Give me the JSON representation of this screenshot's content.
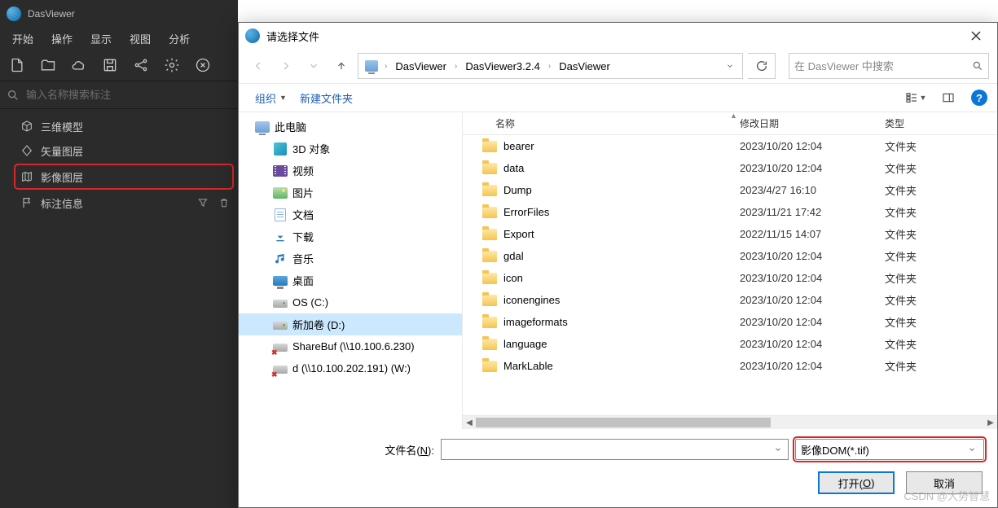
{
  "app": {
    "title": "DasViewer",
    "menubar": [
      "开始",
      "操作",
      "显示",
      "视图",
      "分析"
    ],
    "search_placeholder": "输入名称搜索标注",
    "sidebar": {
      "items": [
        {
          "label": "三维模型"
        },
        {
          "label": "矢量图层"
        },
        {
          "label": "影像图层",
          "highlighted": true
        },
        {
          "label": "标注信息",
          "has_actions": true
        }
      ]
    }
  },
  "dialog": {
    "title": "请选择文件",
    "breadcrumbs": [
      "DasViewer",
      "DasViewer3.2.4",
      "DasViewer"
    ],
    "search_placeholder": "在 DasViewer 中搜索",
    "toolbar": {
      "organize": "组织",
      "new_folder": "新建文件夹"
    },
    "tree": [
      {
        "label": "此电脑",
        "icon": "pc"
      },
      {
        "label": "3D 对象",
        "icon": "3d",
        "indent": true
      },
      {
        "label": "视频",
        "icon": "video",
        "indent": true
      },
      {
        "label": "图片",
        "icon": "pictures",
        "indent": true
      },
      {
        "label": "文档",
        "icon": "docs",
        "indent": true
      },
      {
        "label": "下载",
        "icon": "downloads",
        "indent": true
      },
      {
        "label": "音乐",
        "icon": "music",
        "indent": true
      },
      {
        "label": "桌面",
        "icon": "desktop",
        "indent": true
      },
      {
        "label": "OS (C:)",
        "icon": "drive",
        "indent": true
      },
      {
        "label": "新加卷 (D:)",
        "icon": "drive",
        "indent": true,
        "selected": true
      },
      {
        "label": "ShareBuf (\\\\10.100.6.230)",
        "icon": "netdrive-x",
        "indent": true
      },
      {
        "label": "d (\\\\10.100.202.191) (W:)",
        "icon": "netdrive-x",
        "indent": true
      }
    ],
    "columns": {
      "name": "名称",
      "date": "修改日期",
      "type": "类型"
    },
    "rows": [
      {
        "name": "bearer",
        "date": "2023/10/20 12:04",
        "type": "文件夹"
      },
      {
        "name": "data",
        "date": "2023/10/20 12:04",
        "type": "文件夹"
      },
      {
        "name": "Dump",
        "date": "2023/4/27 16:10",
        "type": "文件夹"
      },
      {
        "name": "ErrorFiles",
        "date": "2023/11/21 17:42",
        "type": "文件夹"
      },
      {
        "name": "Export",
        "date": "2022/11/15 14:07",
        "type": "文件夹"
      },
      {
        "name": "gdal",
        "date": "2023/10/20 12:04",
        "type": "文件夹"
      },
      {
        "name": "icon",
        "date": "2023/10/20 12:04",
        "type": "文件夹"
      },
      {
        "name": "iconengines",
        "date": "2023/10/20 12:04",
        "type": "文件夹"
      },
      {
        "name": "imageformats",
        "date": "2023/10/20 12:04",
        "type": "文件夹"
      },
      {
        "name": "language",
        "date": "2023/10/20 12:04",
        "type": "文件夹"
      },
      {
        "name": "MarkLable",
        "date": "2023/10/20 12:04",
        "type": "文件夹"
      }
    ],
    "footer": {
      "filename_label_pre": "文件名(",
      "filename_label_u": "N",
      "filename_label_post": "):",
      "filter": "影像DOM(*.tif)",
      "open_btn_pre": "打开(",
      "open_btn_u": "O",
      "open_btn_post": ")",
      "cancel_btn": "取消"
    }
  },
  "watermark": "CSDN @大势智慧"
}
